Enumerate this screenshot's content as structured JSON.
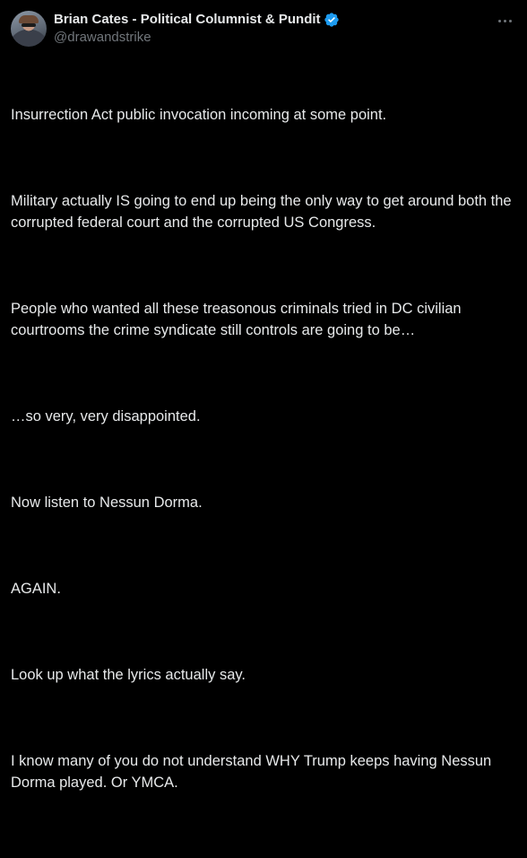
{
  "author": {
    "display_name": "Brian Cates - Political Columnist & Pundit",
    "handle": "@drawandstrike",
    "verified_badge_color": "#1d9bf0"
  },
  "icons": {
    "avatar": "avatar-photo",
    "verified": "verified-badge-icon",
    "more": "more-horizontal-icon"
  },
  "tweet": {
    "paragraphs": [
      "Insurrection Act public invocation incoming at some point.",
      "Military actually IS going to end up being the only way to get around both the corrupted federal court and the corrupted US Congress.",
      "People who wanted all these treasonous criminals tried in DC civilian courtrooms the crime syndicate still controls are going to be…",
      "…so very, very disappointed.",
      "Now listen to Nessun Dorma.",
      "AGAIN.",
      "Look up what the lyrics actually say.",
      "I know many of you do not understand WHY Trump keeps having Nessun Dorma played. Or YMCA."
    ]
  },
  "colors": {
    "background": "#000000",
    "primary_text": "#e7e9ea",
    "secondary_text": "#71767b"
  }
}
